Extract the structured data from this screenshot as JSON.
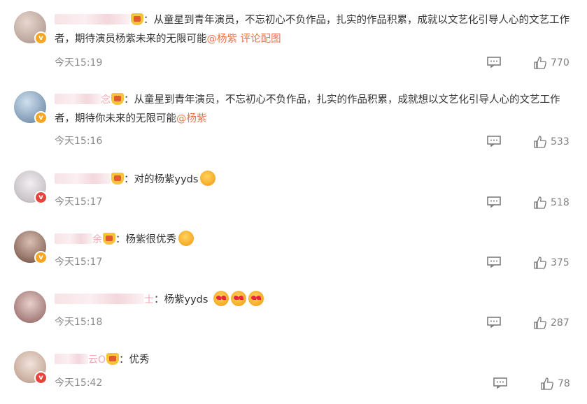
{
  "comments": [
    {
      "text_parts": [
        "：从童星到青年演员，不忘初心不负作品，扎实的作品积累，成就以文艺化引导人心的文艺工作者，期待演员杨紫未来的无限可能"
      ],
      "mention": "@杨紫",
      "extra": " 评论配图",
      "time": "今天15:19",
      "likes": "770",
      "badge": "gold"
    },
    {
      "name_tail": "念",
      "text_parts": [
        "：从童星到青年演员，不忘初心不负作品，扎实的作品积累，成就想以文艺化引导人心的文艺工作者，期待你未来的无限可能"
      ],
      "mention": "@杨紫",
      "time": "今天15:16",
      "likes": "533",
      "badge": "gold"
    },
    {
      "text_parts": [
        "：对的杨紫yyds"
      ],
      "time": "今天15:17",
      "likes": "518",
      "badge": "red",
      "emoji_count": 1
    },
    {
      "name_tail": "余",
      "text_parts": [
        "：杨紫很优秀"
      ],
      "time": "今天15:17",
      "likes": "375",
      "badge": "gold",
      "emoji_count": 1
    },
    {
      "name_tail": "士",
      "text_parts": [
        "：杨紫yyds"
      ],
      "time": "今天15:18",
      "likes": "287",
      "badge": "none",
      "emoji_count": 3
    },
    {
      "name_tail": "云O",
      "text_parts": [
        "：优秀"
      ],
      "time": "今天15:42",
      "likes": "78",
      "badge": "red"
    }
  ],
  "colors": {
    "mention": "#eb7350",
    "time": "#8c8c8c",
    "text": "#333333"
  },
  "icons": {
    "reply": "comment-bubble-icon",
    "like": "thumbs-up-icon",
    "vip": "crown-icon"
  }
}
